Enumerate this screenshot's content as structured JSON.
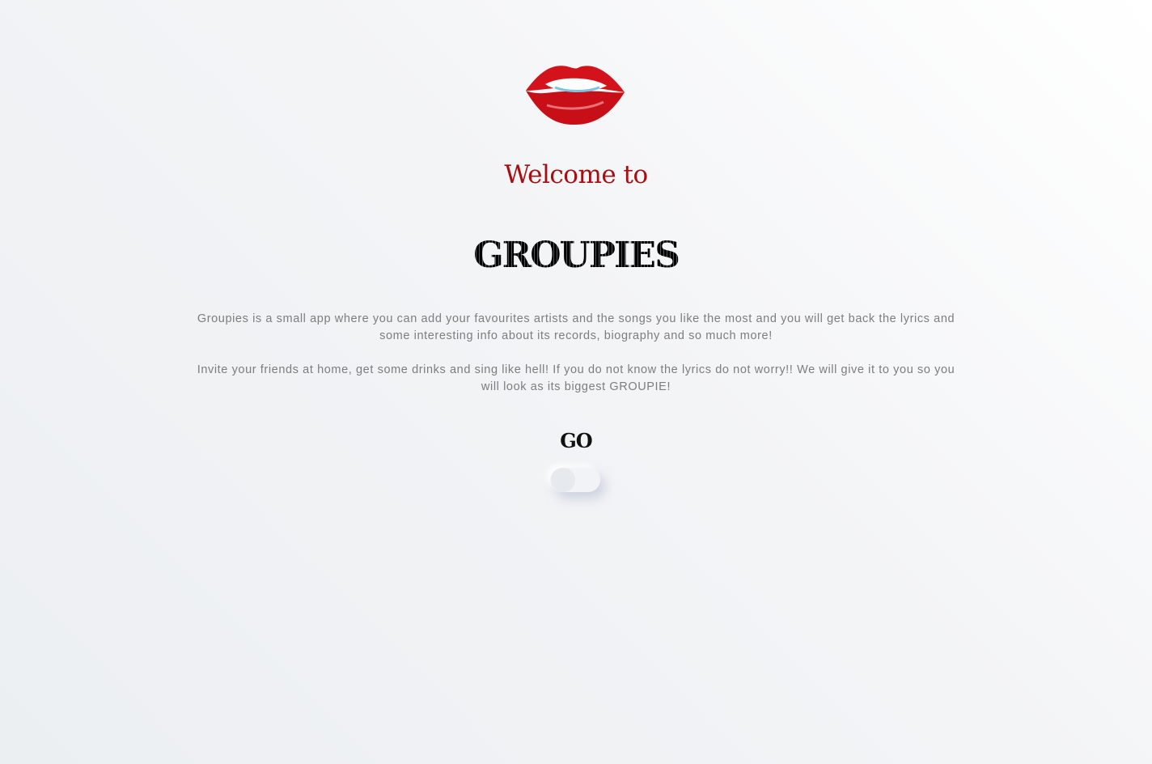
{
  "logo": {
    "icon": "lips-icon",
    "colors": {
      "lip": "#d4121c",
      "teeth": "#ffffff"
    }
  },
  "welcome": "Welcome to",
  "brand": "GROUPIES",
  "description": [
    "Groupies is a small app where you can add your favourites artists and the songs you like the most and you will get back the lyrics and some interesting info about its records, biography and so much more!",
    "Invite your friends at home, get some drinks and sing like hell! If you do not know the lyrics do not worry!! We will give it to you so you will look as its biggest GROUPIE!"
  ],
  "go": {
    "label": "GO",
    "toggle_on": false
  },
  "colors": {
    "accent": "#a50f12",
    "text": "#7d7d7d"
  }
}
